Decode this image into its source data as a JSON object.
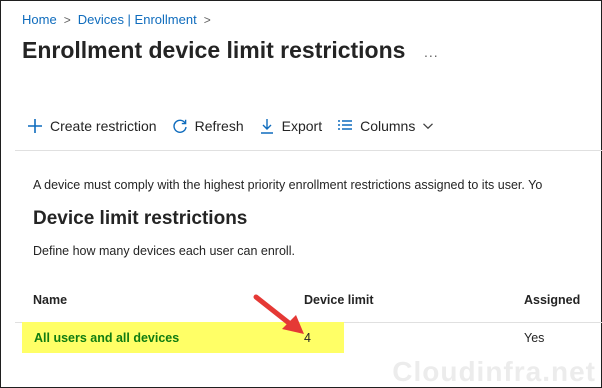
{
  "breadcrumb": {
    "home": "Home",
    "devices": "Devices | Enrollment",
    "sep": ">"
  },
  "page": {
    "title": "Enrollment device limit restrictions",
    "more": "..."
  },
  "toolbar": {
    "create": "Create restriction",
    "refresh": "Refresh",
    "export": "Export",
    "columns": "Columns"
  },
  "intro_text": "A device must comply with the highest priority enrollment restrictions assigned to its user. Yo",
  "section": {
    "title": "Device limit restrictions",
    "description": "Define how many devices each user can enroll."
  },
  "table": {
    "headers": {
      "name": "Name",
      "limit": "Device limit",
      "assigned": "Assigned"
    },
    "rows": [
      {
        "name": "All users and all devices",
        "limit": "4",
        "assigned": "Yes"
      }
    ]
  },
  "watermark": "Cloudinfra.net",
  "colors": {
    "accent": "#0f6cbd",
    "highlight": "#ffff66",
    "arrow": "#e53935",
    "link": "#107c10"
  },
  "icons": [
    "plus-icon",
    "refresh-icon",
    "download-icon",
    "columns-icon",
    "chevron-down-icon",
    "red-arrow"
  ]
}
